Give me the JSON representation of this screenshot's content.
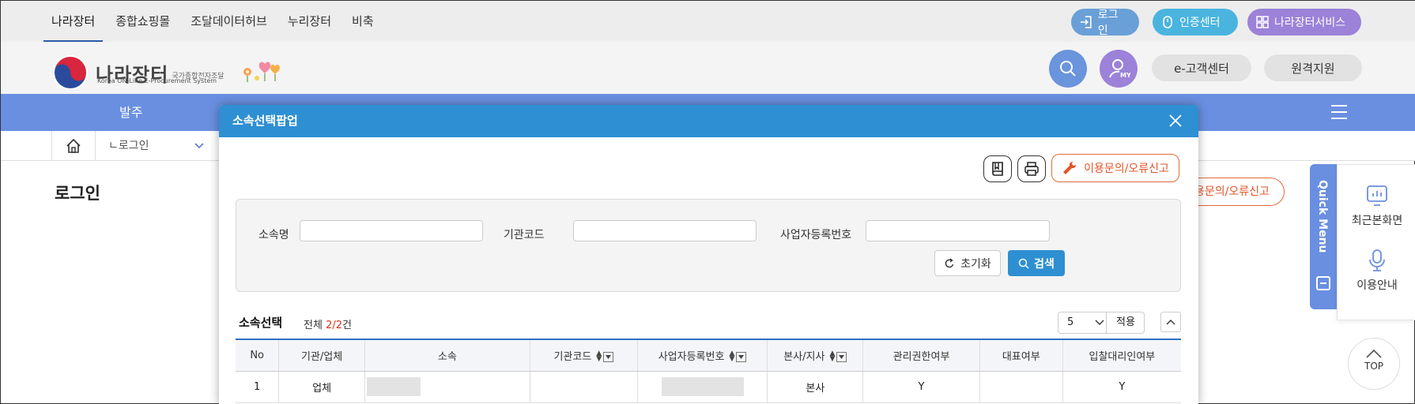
{
  "topnav": {
    "items": [
      "나라장터",
      "종합쇼핑몰",
      "조달데이터허브",
      "누리장터",
      "비축"
    ]
  },
  "top_buttons": {
    "login": "로그인",
    "cert": "인증센터",
    "service": "나라장터서비스"
  },
  "header": {
    "logo_ko": "나라장터",
    "logo_sub": "국가종합전자조달",
    "logo_en": "Korea ON-Line E-Procurement System",
    "my_label": "MY",
    "customer_center": "e-고객센터",
    "remote_support": "원격지원"
  },
  "menubar": {
    "first_menu": "발주"
  },
  "breadcrumb": {
    "location": "ㄴ로그인"
  },
  "page": {
    "title": "로그인",
    "report_partial": "용문의/오류신고"
  },
  "quick_menu": {
    "tab_label": "Quick Menu",
    "recent": "최근본화면",
    "guide": "이용안내",
    "top": "TOP"
  },
  "popup": {
    "title": "소속선택팝업",
    "report_label": "이용문의/오류신고",
    "search": {
      "name_label": "소속명",
      "code_label": "기관코드",
      "bizno_label": "사업자등록번호",
      "name_value": "",
      "code_value": "",
      "bizno_value": "",
      "reset_label": "초기화",
      "search_label": "검색"
    },
    "list": {
      "title": "소속선택",
      "count_prefix": "전체",
      "count": "2/2",
      "count_suffix": "건",
      "page_size": "5",
      "apply_label": "적용"
    },
    "table": {
      "columns": [
        "No",
        "기관/업체",
        "소속",
        "기관코드",
        "사업자등록번호",
        "본사/지사",
        "관리권한여부",
        "대표여부",
        "입찰대리인여부"
      ],
      "rows": [
        {
          "no": "1",
          "type": "업체",
          "affiliation": "",
          "code": "",
          "bizno": "",
          "hq": "본사",
          "admin": "Y",
          "rep": "",
          "agent": "Y"
        }
      ]
    }
  },
  "colors": {
    "popup_header": "#2e8fd2",
    "menubar": "#6a8fe0",
    "report_orange": "#e0552a"
  }
}
